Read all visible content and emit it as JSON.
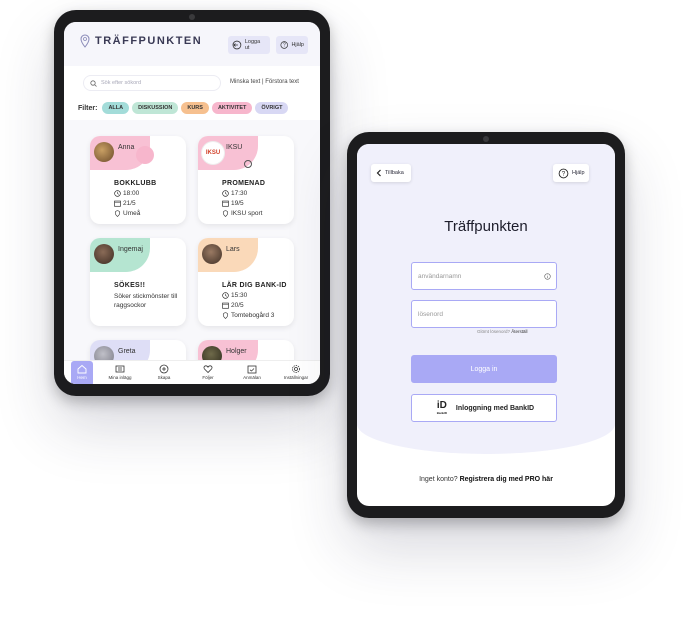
{
  "left_app": {
    "logo_text": "TRÄFFPUNKTEN",
    "logout_label": "Logga ut",
    "help_label": "Hjälp",
    "search_placeholder": "Sök efter sökord",
    "text_size": {
      "decrease": "Minska text",
      "separator": "|",
      "increase": "Förstora text"
    },
    "filter_label": "Filter:",
    "filters": [
      {
        "label": "ALLA",
        "color": "#a3dcd9"
      },
      {
        "label": "DISKUSSION",
        "color": "#bfe6d6"
      },
      {
        "label": "KURS",
        "color": "#f6c08f"
      },
      {
        "label": "AKTIVITET",
        "color": "#f7b6cc"
      },
      {
        "label": "ÖVRIGT",
        "color": "#d8d8f4"
      }
    ],
    "cards": [
      {
        "name": "Anna",
        "title": "BOKKLUBB",
        "time": "18:00",
        "date": "21/5",
        "place": "Umeå",
        "color": "#f7b6cc"
      },
      {
        "name": "IKSU",
        "logo": "IKSU",
        "title": "PROMENAD",
        "time": "17:30",
        "date": "19/5",
        "place": "IKSU sport",
        "color": "#f7b6cc"
      },
      {
        "name": "Ingemaj",
        "title": "SÖKES!!",
        "description": "Söker stickmönster till raggsockor",
        "color": "#a8e0c9"
      },
      {
        "name": "Lars",
        "title": "LÄR DIG BANK-ID",
        "time": "15:30",
        "date": "20/5",
        "place": "Tomtebogård 3",
        "color": "#f9d2ad"
      },
      {
        "name": "Greta",
        "color": "#d8d8f4"
      },
      {
        "name": "Holger",
        "color": "#f7b6cc"
      }
    ],
    "nav": [
      {
        "label": "Hem",
        "icon": "home-icon",
        "active": true
      },
      {
        "label": "Mina inlägg",
        "icon": "posts-icon",
        "active": false
      },
      {
        "label": "Skapa",
        "icon": "plus-icon",
        "active": false
      },
      {
        "label": "Följer",
        "icon": "heart-icon",
        "active": false
      },
      {
        "label": "Anmälan",
        "icon": "calendar-icon",
        "active": false
      },
      {
        "label": "Inställningar",
        "icon": "gear-icon",
        "active": false
      }
    ]
  },
  "right_app": {
    "back_label": "Tillbaka",
    "help_label": "Hjälp",
    "title": "Träffpunkten",
    "username_placeholder": "användarnamn",
    "password_placeholder": "lösenord",
    "forgot_prefix": "Glömt lösenord?",
    "forgot_link": "Återställ",
    "login_label": "Logga in",
    "bankid_label": "Inloggning med BankID",
    "bankid_logo_text": "BankID",
    "register_prefix": "Inget konto?",
    "register_link": "Registrera dig med PRO här",
    "accent_color": "#a9a9f5"
  }
}
